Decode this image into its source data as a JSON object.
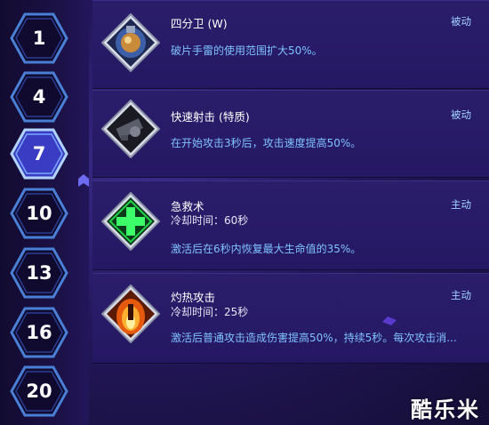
{
  "colors": {
    "hex_border": "#4a7fd6",
    "hex_border_active": "#b0d4ff",
    "hex_fill": "#0f0a2e",
    "hex_fill_active": "#3a3dc4",
    "panel": "#2a1d6a",
    "desc_text": "#7fc2ff",
    "type_text": "#9fd0ff"
  },
  "tiers": [
    {
      "level": "1",
      "active": false
    },
    {
      "level": "4",
      "active": false
    },
    {
      "level": "7",
      "active": true
    },
    {
      "level": "10",
      "active": false
    },
    {
      "level": "13",
      "active": false
    },
    {
      "level": "16",
      "active": false
    },
    {
      "level": "20",
      "active": false
    }
  ],
  "talents": [
    {
      "name": "四分卫 (W)",
      "type": "被动",
      "cooldown": "",
      "description": "破片手雷的使用范围扩大50%。",
      "icon": "grenade-icon"
    },
    {
      "name": "快速射击 (特质)",
      "type": "被动",
      "cooldown": "",
      "description": "在开始攻击3秒后，攻击速度提高50%。",
      "icon": "gun-icon"
    },
    {
      "name": "急救术",
      "type": "主动",
      "cooldown": "冷却时间：60秒",
      "description": "激活后在6秒内恢复最大生命值的35%。",
      "icon": "medical-cross-icon"
    },
    {
      "name": "灼热攻击",
      "type": "主动",
      "cooldown": "冷却时间：25秒",
      "description": "激活后普通攻击造成伤害提高50%，持续5秒。每次攻击消...",
      "icon": "fire-icon"
    }
  ],
  "watermark": "酷乐米"
}
